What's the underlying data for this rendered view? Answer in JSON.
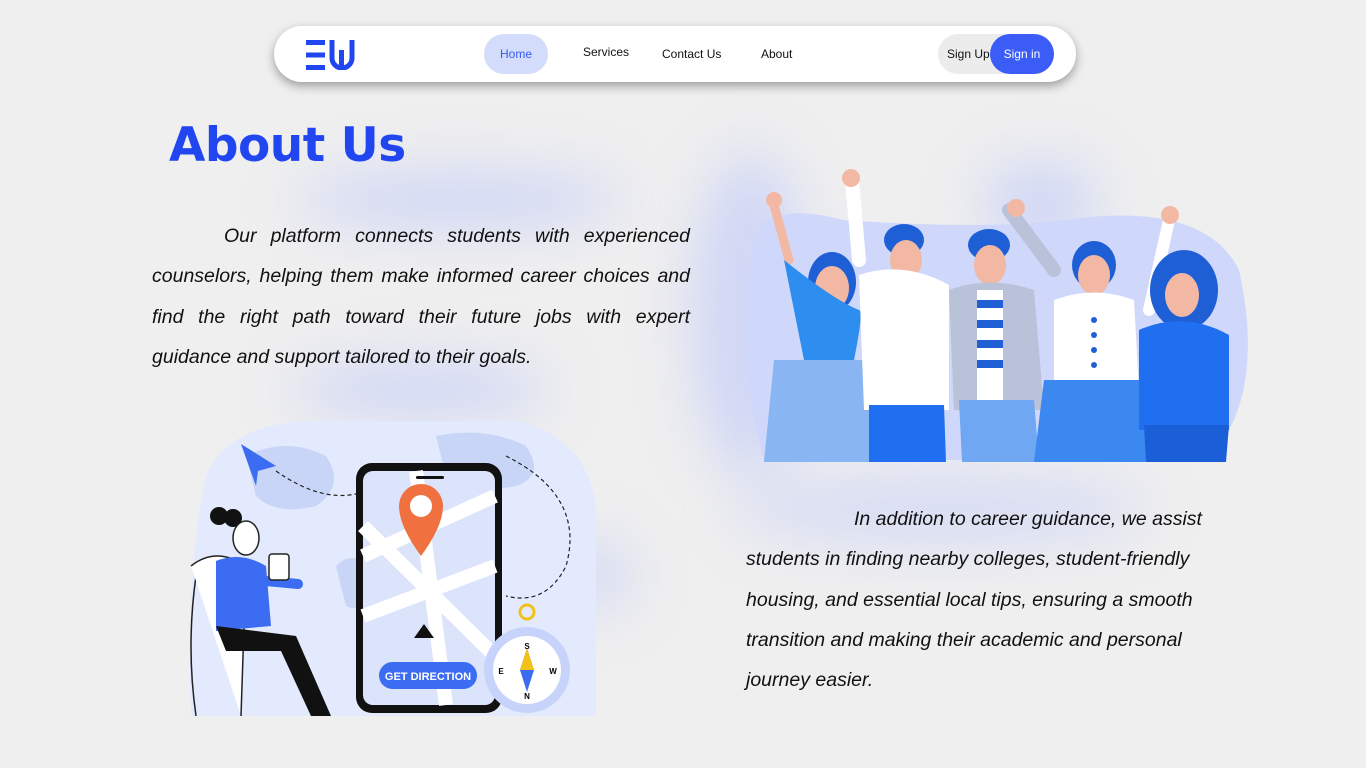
{
  "nav": {
    "logo_text": "EU",
    "links": [
      "Home",
      "Services",
      "Contact Us",
      "About"
    ],
    "active": "Home",
    "signup_label": "Sign Up",
    "signin_label": "Sign in"
  },
  "about": {
    "title": "About Us",
    "paragraph_1": "Our platform connects students with experienced counselors, helping them make informed career choices and find the right path toward their future jobs with expert guidance and support tailored to their goals.",
    "paragraph_2": "In addition to career guidance, we assist students in finding nearby colleges, student-friendly housing, and essential local tips, ensuring a smooth transition and making their academic and personal journey easier."
  },
  "illustration_map": {
    "button_label": "GET DIRECTION",
    "compass": {
      "s": "S",
      "e": "E",
      "w": "W",
      "n": "N"
    },
    "icons": [
      "map-pin-icon",
      "compass-icon",
      "paper-plane-icon"
    ]
  },
  "colors": {
    "accent": "#2146f0",
    "signin_bg": "#3b5cf6",
    "home_pill": "#d3dcfb",
    "background": "#efefef"
  }
}
